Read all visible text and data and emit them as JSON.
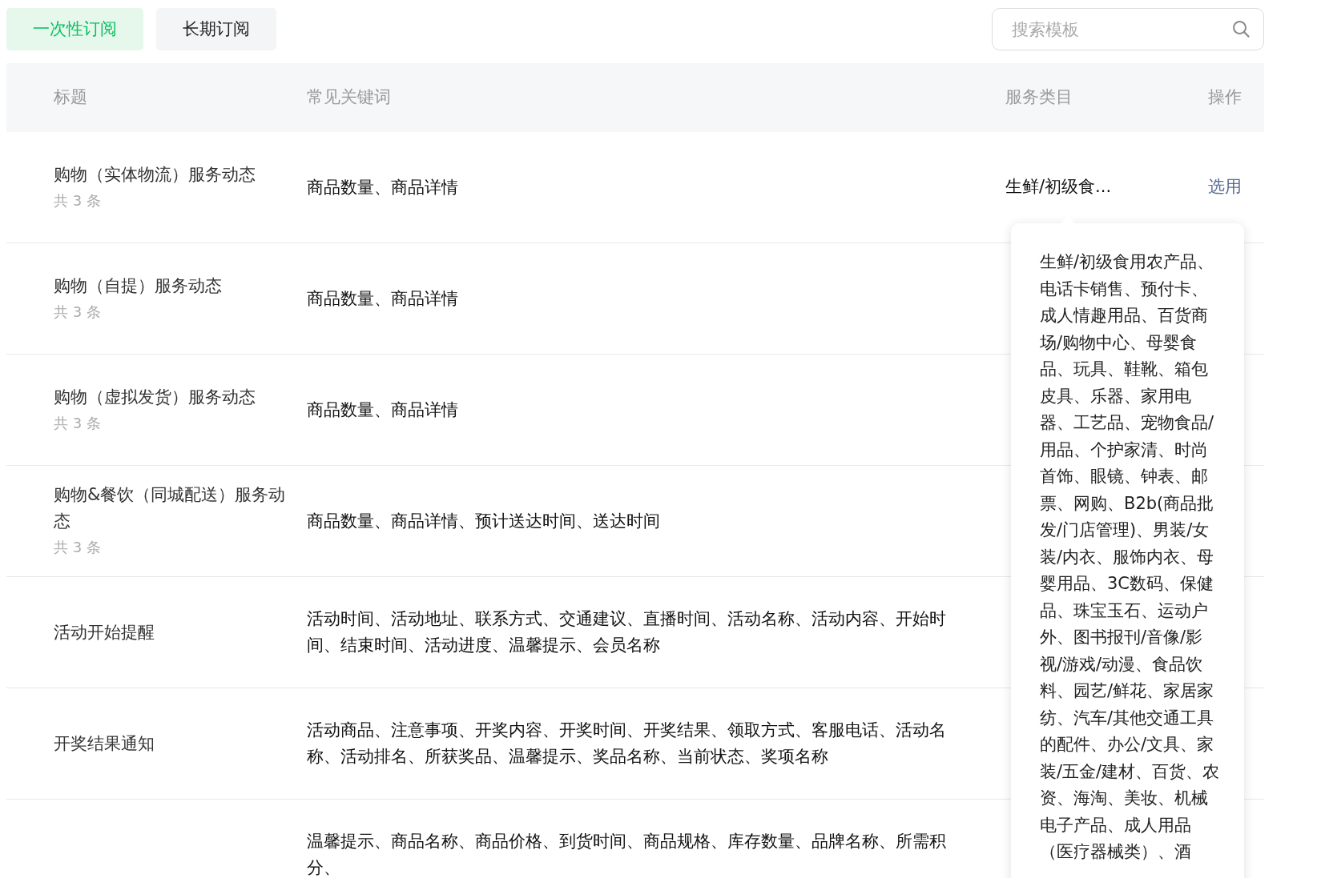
{
  "tabs": [
    {
      "label": "一次性订阅",
      "selected": true
    },
    {
      "label": "长期订阅",
      "selected": false
    }
  ],
  "search": {
    "placeholder": "搜索模板"
  },
  "table": {
    "columns": [
      "标题",
      "常见关键词",
      "服务类目",
      "操作"
    ],
    "rows": [
      {
        "title": "购物（实体物流）服务动态",
        "count": "共 3 条",
        "keywords": "商品数量、商品详情",
        "category": "生鲜/初级食...",
        "action": "选用"
      },
      {
        "title": "购物（自提）服务动态",
        "count": "共 3 条",
        "keywords": "商品数量、商品详情"
      },
      {
        "title": "购物（虚拟发货）服务动态",
        "count": "共 3 条",
        "keywords": "商品数量、商品详情"
      },
      {
        "title": "购物&餐饮（同城配送）服务动态",
        "count": "共 3 条",
        "keywords": "商品数量、商品详情、预计送达时间、送达时间"
      },
      {
        "title": "活动开始提醒",
        "keywords": "活动时间、活动地址、联系方式、交通建议、直播时间、活动名称、活动内容、开始时间、结束时间、活动进度、温馨提示、会员名称"
      },
      {
        "title": "开奖结果通知",
        "keywords": "活动商品、注意事项、开奖内容、开奖时间、开奖结果、领取方式、客服电话、活动名称、活动排名、所获奖品、温馨提示、奖品名称、当前状态、奖项名称"
      },
      {
        "keywords": "温馨提示、商品名称、商品价格、到货时间、商品规格、库存数量、品牌名称、所需积分、"
      }
    ]
  },
  "tooltip": {
    "text": "生鲜/初级食用农产品、电话卡销售、预付卡、成人情趣用品、百货商场/购物中心、母婴食品、玩具、鞋靴、箱包皮具、乐器、家用电器、工艺品、宠物食品/用品、个护家清、时尚首饰、眼镜、钟表、邮票、网购、B2b(商品批发/门店管理)、男装/女装/内衣、服饰内衣、母婴用品、3C数码、保健品、珠宝玉石、运动户外、图书报刊/音像/影视/游戏/动漫、食品饮料、园艺/鲜花、家居家纺、汽车/其他交通工具的配件、办公/文具、家装/五金/建材、百货、农资、海淘、美妆、机械电子产品、成人用品（医疗器械类）、酒"
  }
}
